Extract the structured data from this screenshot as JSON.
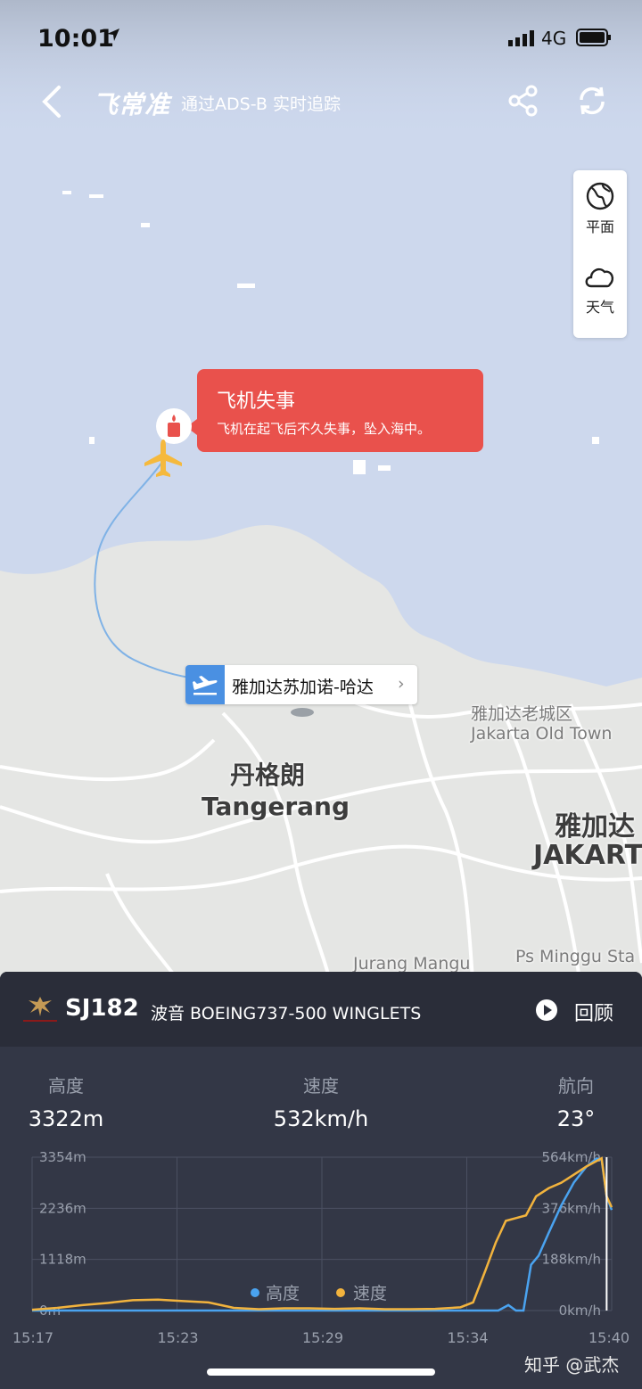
{
  "status_bar": {
    "time": "10:01",
    "network": "4G"
  },
  "nav": {
    "brand": "飞常准",
    "subtitle": "通过ADS-B 实时追踪"
  },
  "side_controls": [
    {
      "label": "平面",
      "icon": "globe-icon"
    },
    {
      "label": "天气",
      "icon": "cloud-icon"
    }
  ],
  "alert": {
    "title": "飞机失事",
    "message": "飞机在起飞后不久失事，坠入海中。",
    "color": "#e9514c"
  },
  "airport": {
    "label": "雅加达苏加诺-哈达",
    "chevron": "›"
  },
  "map_labels": {
    "tangerang_cn": "丹格朗",
    "tangerang_en": "Tangerang",
    "old_town_cn": "雅加达老城区",
    "old_town_en": "Jakarta Old Town",
    "jakarta_cn": "雅加达",
    "jakarta_en": "JAKART",
    "jurang_mangu": "Jurang Mangu",
    "ps_minggu": "Ps Minggu Sta"
  },
  "flight": {
    "number": "SJ182",
    "aircraft": "波音 BOEING737-500 WINGLETS",
    "replay": "回顾"
  },
  "stats": [
    {
      "label": "高度",
      "value": "3322m"
    },
    {
      "label": "速度",
      "value": "532km/h"
    },
    {
      "label": "航向",
      "value": "23°"
    }
  ],
  "chart_data": {
    "type": "line",
    "title": "",
    "x_ticks": [
      "15:17",
      "15:23",
      "15:29",
      "15:34",
      "15:40"
    ],
    "y_left_ticks": [
      "0m",
      "1118m",
      "2236m",
      "3354m"
    ],
    "y_right_ticks": [
      "0km/h",
      "188km/h",
      "376km/h",
      "564km/h"
    ],
    "ylim_left": [
      0,
      3354
    ],
    "ylim_right": [
      0,
      564
    ],
    "xlim_minutes": [
      0,
      23
    ],
    "legend": [
      "高度",
      "速度"
    ],
    "colors": {
      "altitude": "#4aa3f0",
      "speed": "#f2b33d"
    },
    "series": [
      {
        "name": "高度",
        "x": [
          0,
          18.5,
          18.9,
          19.2,
          19.5,
          19.8,
          20.1,
          20.5,
          21,
          21.5,
          22.0,
          22.4,
          22.6,
          22.8,
          23.0
        ],
        "y": [
          0,
          0,
          120,
          0,
          0,
          1000,
          1200,
          1700,
          2300,
          2800,
          3150,
          3322,
          3300,
          2500,
          2200
        ]
      },
      {
        "name": "速度",
        "x": [
          0,
          1,
          2,
          3,
          4,
          5,
          6,
          7,
          8,
          9,
          10,
          11,
          12,
          13,
          14,
          15,
          16,
          17,
          17.5,
          18,
          18.4,
          18.8,
          19.2,
          19.6,
          20,
          20.5,
          21,
          21.5,
          22,
          22.3,
          22.6,
          22.8,
          23
        ],
        "y": [
          3,
          10,
          20,
          28,
          38,
          40,
          35,
          30,
          10,
          5,
          8,
          8,
          6,
          8,
          5,
          5,
          6,
          12,
          30,
          150,
          250,
          330,
          340,
          350,
          420,
          450,
          470,
          500,
          530,
          545,
          560,
          420,
          380
        ]
      }
    ]
  },
  "watermark": "知乎 @武杰"
}
